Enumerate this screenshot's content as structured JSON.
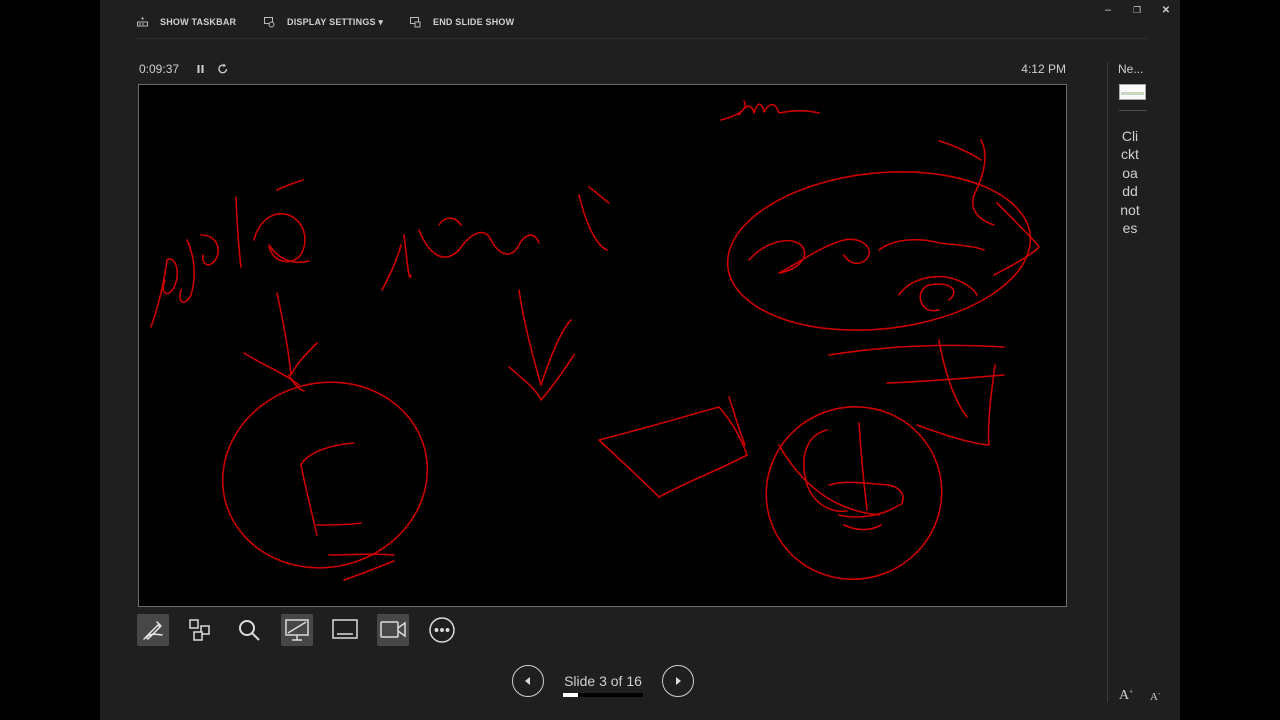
{
  "toolbar": {
    "show_taskbar": "SHOW TASKBAR",
    "display_settings": "DISPLAY SETTINGS ▾",
    "end_slide_show": "END SLIDE SHOW"
  },
  "window_controls": {
    "minimize": "–",
    "restore": "❐",
    "close": "✕"
  },
  "presenter": {
    "elapsed_time": "0:09:37",
    "clock": "4:12 PM"
  },
  "navigation": {
    "slide_counter": "Slide 3 of 16",
    "current_slide": 3,
    "total_slides": 16,
    "progress_fraction": 0.1875
  },
  "notes": {
    "next_label": "Ne...",
    "notes_text": "Clicktoaddnotes"
  },
  "tools": [
    "pen-icon",
    "slides-grid-icon",
    "zoom-icon",
    "black-screen-icon",
    "subtitles-icon",
    "camera-icon",
    "more-options-icon"
  ],
  "colors": {
    "ink": "#cc0000",
    "background": "#1f1f1f",
    "slide_background": "#000000"
  }
}
